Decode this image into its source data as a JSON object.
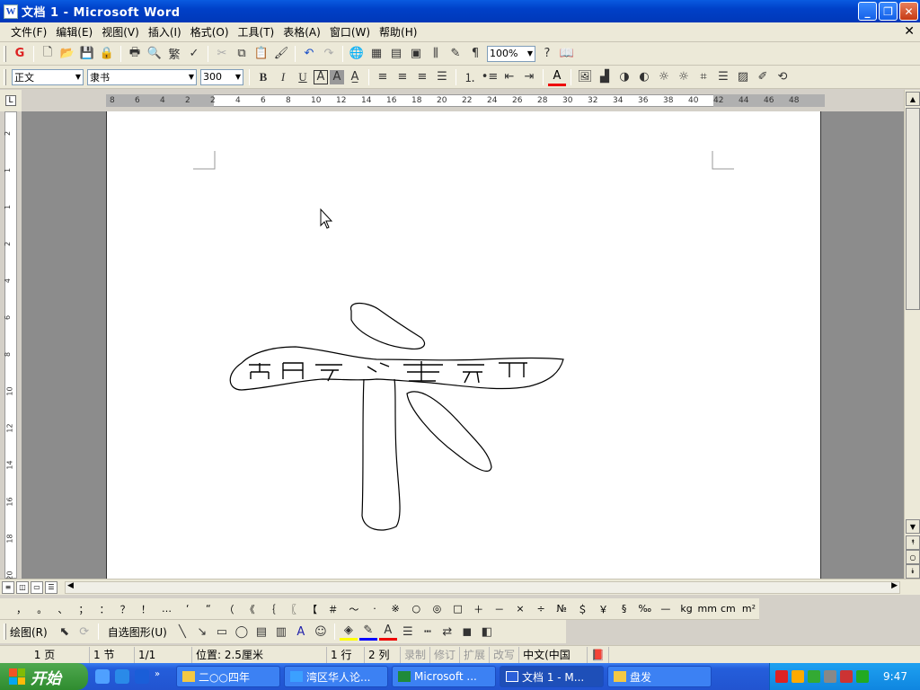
{
  "window": {
    "title": "文档 1 - Microsoft Word",
    "app_icon": "W"
  },
  "menu": [
    "文件(F)",
    "编辑(E)",
    "视图(V)",
    "插入(I)",
    "格式(O)",
    "工具(T)",
    "表格(A)",
    "窗口(W)",
    "帮助(H)"
  ],
  "toolbar": {
    "zoom": "100%",
    "style": "正文",
    "font": "隶书",
    "size": "300",
    "trad_label": "繁"
  },
  "ruler": {
    "h_ticks": [
      "8",
      "6",
      "4",
      "2",
      "2",
      "4",
      "6",
      "8",
      "10",
      "12",
      "14",
      "16",
      "18",
      "20",
      "22",
      "24",
      "26",
      "28",
      "30",
      "32",
      "34",
      "36",
      "38",
      "40",
      "42",
      "44",
      "46",
      "48"
    ],
    "v_ticks": [
      "2",
      "1",
      "1",
      "2",
      "4",
      "6",
      "8",
      "10",
      "12",
      "14",
      "16",
      "18",
      "20"
    ]
  },
  "symbols": [
    "，",
    "。",
    "、",
    "；",
    "：",
    "？",
    "！",
    "…",
    "‘",
    "“",
    "（",
    "《",
    "｛",
    "〖",
    "【",
    "＃",
    "～",
    "·",
    "※",
    "○",
    "◎",
    "□",
    "＋",
    "－",
    "×",
    "÷",
    "№",
    "＄",
    "￥",
    "§",
    "‰",
    "—",
    "kg",
    "mm",
    "cm",
    "m²"
  ],
  "drawbar": {
    "draw_label": "绘图(R)",
    "autoshape_label": "自选图形(U)"
  },
  "status": {
    "page": "1 页",
    "section": "1 节",
    "pages": "1/1",
    "position": "位置: 2.5厘米",
    "line": "1 行",
    "col": "2 列",
    "rec": "录制",
    "trk": "修订",
    "ext": "扩展",
    "ovr": "改写",
    "lang": "中文(中国"
  },
  "taskbar": {
    "start": "开始",
    "items": [
      {
        "label": "二○○四年",
        "icon": "folder"
      },
      {
        "label": "湾区华人论...",
        "icon": "ie"
      },
      {
        "label": "Microsoft ...",
        "icon": "excel"
      },
      {
        "label": "文档 1 - M...",
        "icon": "word"
      },
      {
        "label": "盘发",
        "icon": "folder"
      }
    ],
    "clock": "9:47"
  }
}
